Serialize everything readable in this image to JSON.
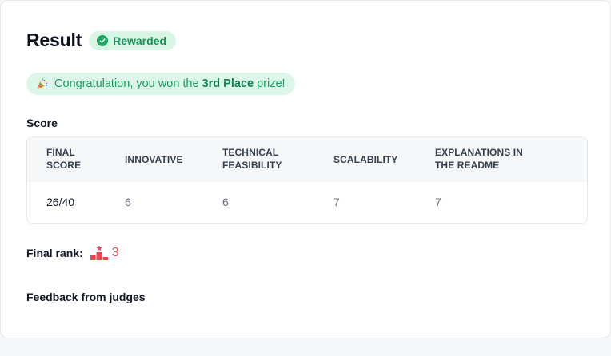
{
  "result": {
    "title": "Result",
    "badge_label": "Rewarded"
  },
  "banner": {
    "icon": "party-popper-icon",
    "prefix": "Congratulation, you won the ",
    "place": "3rd Place",
    "suffix": " prize!"
  },
  "score": {
    "label": "Score",
    "columns": [
      "FINAL SCORE",
      "INNOVATIVE",
      "TECHNICAL FEASIBILITY",
      "SCALABILITY",
      "EXPLANATIONS IN THE README"
    ],
    "values": [
      "26/40",
      "6",
      "6",
      "7",
      "7"
    ]
  },
  "rank": {
    "label": "Final rank:",
    "icon": "podium-icon",
    "value": "3"
  },
  "feedback": {
    "label": "Feedback from judges"
  },
  "colors": {
    "accent_green": "#17a865",
    "badge_bg": "#d8f5e6",
    "rank_red": "#e5484d"
  }
}
